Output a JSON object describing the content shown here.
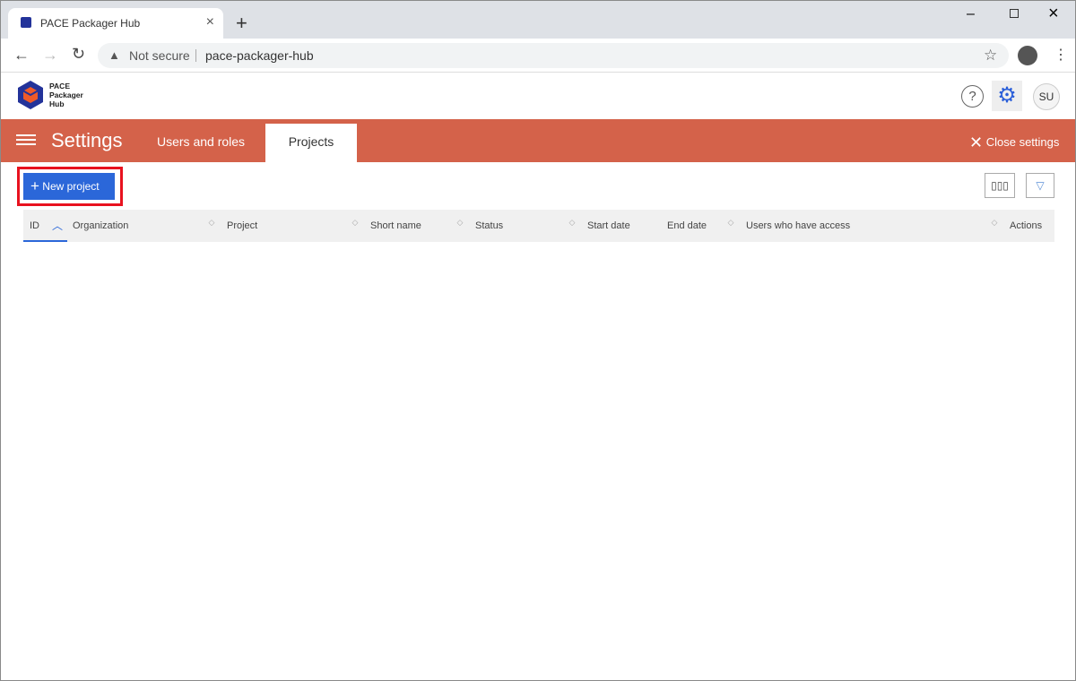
{
  "browser": {
    "tab_title": "PACE Packager Hub",
    "security": "Not secure",
    "url": "pace-packager-hub"
  },
  "app": {
    "logo_text": [
      "PACE",
      "Packager",
      "Hub"
    ],
    "avatar": "SU"
  },
  "settings": {
    "title": "Settings",
    "tabs": [
      {
        "label": "Users and roles",
        "active": false
      },
      {
        "label": "Projects",
        "active": true
      }
    ],
    "close_label": "Close settings"
  },
  "toolbar": {
    "new_project": "New project"
  },
  "table": {
    "columns": [
      "ID",
      "Organization",
      "Project",
      "Short name",
      "Status",
      "Start date",
      "End date",
      "Users who have access",
      "Actions"
    ],
    "sorted_column": "ID",
    "sort_direction": "ascending",
    "rows": []
  },
  "colors": {
    "header": "#d4624a",
    "primary": "#2b67d9",
    "highlight": "#e8121f"
  }
}
